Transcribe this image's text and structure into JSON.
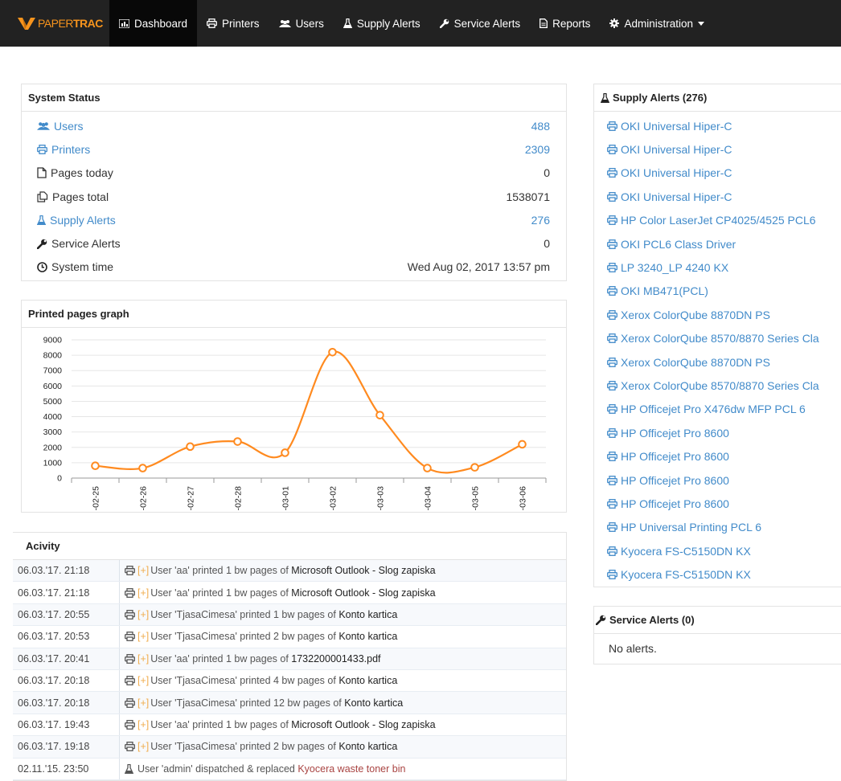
{
  "nav": {
    "brand_part1": "PAPER",
    "brand_part2": "TRAC",
    "items": [
      {
        "label": "Dashboard",
        "icon": "bar-chart-icon"
      },
      {
        "label": "Printers",
        "icon": "printer-icon"
      },
      {
        "label": "Users",
        "icon": "users-icon"
      },
      {
        "label": "Supply Alerts",
        "icon": "flask-icon"
      },
      {
        "label": "Service Alerts",
        "icon": "wrench-icon"
      },
      {
        "label": "Reports",
        "icon": "document-icon"
      },
      {
        "label": "Administration",
        "icon": "gear-icon"
      }
    ]
  },
  "system_status": {
    "title": "System Status",
    "rows": [
      {
        "label": "Users",
        "value": "488",
        "icon": "users-icon",
        "link": true
      },
      {
        "label": "Printers",
        "value": "2309",
        "icon": "printer-icon",
        "link": true
      },
      {
        "label": "Pages today",
        "value": "0",
        "icon": "page-icon",
        "link": false
      },
      {
        "label": "Pages total",
        "value": "1538071",
        "icon": "pages-copy-icon",
        "link": false
      },
      {
        "label": "Supply Alerts",
        "value": "276",
        "icon": "flask-icon",
        "link": true
      },
      {
        "label": "Service Alerts",
        "value": "0",
        "icon": "wrench-icon",
        "link": false
      },
      {
        "label": "System time",
        "value": "Wed Aug 02, 2017 13:57 pm",
        "icon": "clock-icon",
        "link": false
      }
    ]
  },
  "graph": {
    "title": "Printed pages graph"
  },
  "chart_data": {
    "type": "line",
    "x": [
      "2017-02-25",
      "2017-02-26",
      "2017-02-27",
      "2017-02-28",
      "2017-03-01",
      "2017-03-02",
      "2017-03-03",
      "2017-03-04",
      "2017-03-05",
      "2017-03-06"
    ],
    "series": [
      {
        "values": [
          800,
          650,
          2050,
          2380,
          1650,
          8200,
          4100,
          650,
          700,
          2200
        ]
      }
    ],
    "yticks": [
      "9000",
      "8000",
      "7000",
      "6000",
      "5000",
      "4000",
      "3000",
      "2000",
      "1000",
      "0"
    ],
    "ylim": [
      0,
      9000
    ],
    "grid": true,
    "line_color": "#ff8a1f"
  },
  "activity": {
    "title": "Acivity",
    "rows": [
      {
        "time": "06.03.'17. 21:18",
        "icon": "printer-icon",
        "plus": "[+]",
        "text": "User 'aa' printed 1 bw pages of",
        "object": "Microsoft Outlook - Slog zapiska"
      },
      {
        "time": "06.03.'17. 21:18",
        "icon": "printer-icon",
        "plus": "[+]",
        "text": "User 'aa' printed 1 bw pages of",
        "object": "Microsoft Outlook - Slog zapiska"
      },
      {
        "time": "06.03.'17. 20:55",
        "icon": "printer-icon",
        "plus": "[+]",
        "text": "User 'TjasaCimesa' printed 1 bw pages of",
        "object": "Konto kartica"
      },
      {
        "time": "06.03.'17. 20:53",
        "icon": "printer-icon",
        "plus": "[+]",
        "text": "User 'TjasaCimesa' printed 2 bw pages of",
        "object": "Konto kartica"
      },
      {
        "time": "06.03.'17. 20:41",
        "icon": "printer-icon",
        "plus": "[+]",
        "text": "User 'aa' printed 1 bw pages of",
        "object": "1732200001433.pdf"
      },
      {
        "time": "06.03.'17. 20:18",
        "icon": "printer-icon",
        "plus": "[+]",
        "text": "User 'TjasaCimesa' printed 4 bw pages of",
        "object": "Konto kartica"
      },
      {
        "time": "06.03.'17. 20:18",
        "icon": "printer-icon",
        "plus": "[+]",
        "text": "User 'TjasaCimesa' printed 12 bw pages of",
        "object": "Konto kartica"
      },
      {
        "time": "06.03.'17. 19:43",
        "icon": "printer-icon",
        "plus": "[+]",
        "text": "User 'aa' printed 1 bw pages of",
        "object": "Microsoft Outlook - Slog zapiska"
      },
      {
        "time": "06.03.'17. 19:18",
        "icon": "printer-icon",
        "plus": "[+]",
        "text": "User 'TjasaCimesa' printed 2 bw pages of",
        "object": "Konto kartica"
      },
      {
        "time": "02.11.'15. 23:50",
        "icon": "flask-icon",
        "plus": "",
        "text": "User 'admin' dispatched & replaced",
        "object": "Kyocera waste toner bin",
        "red": true
      }
    ]
  },
  "supply_alerts": {
    "title": "Supply Alerts (276)",
    "items": [
      {
        "label": "OKI Universal Hiper-C",
        "bold": true
      },
      {
        "label": "OKI Universal Hiper-C",
        "bold": true
      },
      {
        "label": "OKI Universal Hiper-C",
        "bold": true
      },
      {
        "label": "OKI Universal Hiper-C",
        "bold": true
      },
      {
        "label": "HP Color LaserJet CP4025/4525 PCL6",
        "bold": true
      },
      {
        "label": "OKI PCL6 Class Driver",
        "bold": true
      },
      {
        "label": "LP 3240_LP 4240 KX",
        "bold": true
      },
      {
        "label": "OKI MB471(PCL)",
        "bold": true
      },
      {
        "label": "Xerox ColorQube 8870DN PS",
        "bold": false
      },
      {
        "label": "Xerox ColorQube 8570/8870 Series Cla",
        "bold": false
      },
      {
        "label": "Xerox ColorQube 8870DN PS",
        "bold": false
      },
      {
        "label": "Xerox ColorQube 8570/8870 Series Cla",
        "bold": false
      },
      {
        "label": "HP Officejet Pro X476dw MFP PCL 6",
        "bold": true
      },
      {
        "label": "HP Officejet Pro 8600",
        "bold": true
      },
      {
        "label": "HP Officejet Pro 8600",
        "bold": true
      },
      {
        "label": "HP Officejet Pro 8600",
        "bold": true
      },
      {
        "label": "HP Officejet Pro 8600",
        "bold": true
      },
      {
        "label": "HP Universal Printing PCL 6",
        "bold": true
      },
      {
        "label": "Kyocera FS-C5150DN KX",
        "bold": true
      },
      {
        "label": "Kyocera FS-C5150DN KX",
        "bold": true
      }
    ]
  },
  "service_alerts": {
    "title": "Service Alerts (0)",
    "empty_text": "No alerts."
  }
}
